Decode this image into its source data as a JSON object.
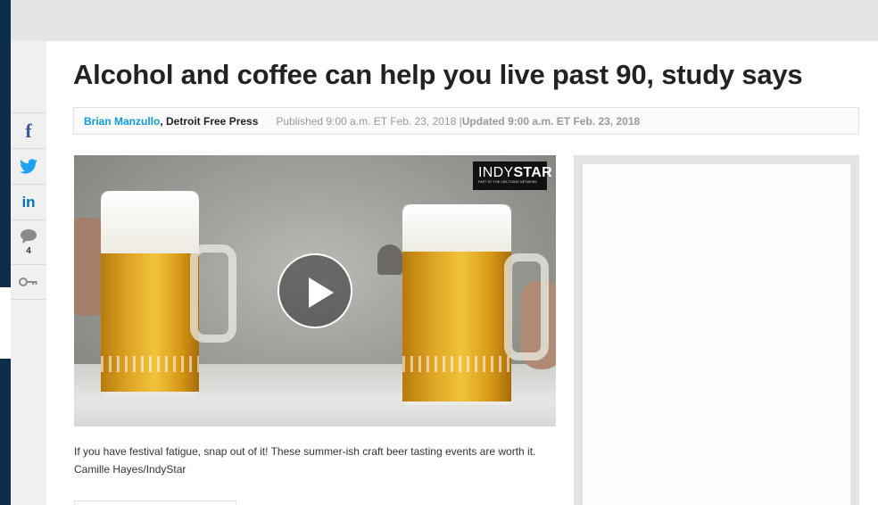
{
  "article": {
    "headline": "Alcohol and coffee can help you live past 90, study says",
    "byline": {
      "author": "Brian Manzullo",
      "source": ", Detroit Free Press",
      "published": "Published 9:00 a.m. ET Feb. 23, 2018 | ",
      "updated": "Updated 9:00 a.m. ET Feb. 23, 2018"
    },
    "video": {
      "logo": {
        "light": "INDY",
        "bold": "STAR",
        "tagline": "PART OF THE USA TODAY NETWORK"
      },
      "play_icon": "play-icon"
    },
    "caption": {
      "text": "If you have festival fatigue, snap out of it! These summer-ish craft beer tasting events are worth it.",
      "credit": "Camille Hayes/IndyStar"
    }
  },
  "share_rail": {
    "items": [
      {
        "icon": "facebook-icon",
        "color": "#3b5998"
      },
      {
        "icon": "twitter-icon",
        "color": "#1da1f2"
      },
      {
        "icon": "linkedin-icon",
        "color": "#0077b5",
        "glyph": "in"
      },
      {
        "icon": "comment-icon",
        "color": "#8a8a8a",
        "count": "4"
      },
      {
        "icon": "key-icon",
        "color": "#8a8a8a"
      }
    ]
  },
  "colors": {
    "author_link": "#0e9be0",
    "headline": "#222222",
    "left_edge": "#0b2f4a"
  }
}
